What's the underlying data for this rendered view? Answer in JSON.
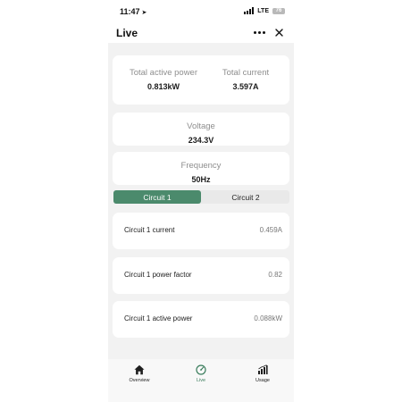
{
  "status_bar": {
    "time": "11:47",
    "network": "LTE",
    "battery": "76"
  },
  "header": {
    "title": "Live"
  },
  "power": {
    "active_label": "Total active power",
    "active_value": "0.813kW",
    "current_label": "Total current",
    "current_value": "3.597A"
  },
  "voltage": {
    "label": "Voltage",
    "value": "234.3V"
  },
  "frequency": {
    "label": "Frequency",
    "value": "50Hz"
  },
  "circuit_tabs": {
    "tab1": "Circuit 1",
    "tab2": "Circuit 2",
    "selected": "Circuit 1"
  },
  "circuit_metrics": [
    {
      "label": "Circuit 1 current",
      "value": "0.459A"
    },
    {
      "label": "Circuit 1 power factor",
      "value": "0.82"
    },
    {
      "label": "Circuit 1 active power",
      "value": "0.088kW"
    }
  ],
  "tab_bar": {
    "items": [
      {
        "label": "Overview",
        "icon": "home-icon"
      },
      {
        "label": "Live",
        "icon": "gauge-icon"
      },
      {
        "label": "Usage",
        "icon": "bar-chart-icon"
      }
    ],
    "active": "Live"
  },
  "colors": {
    "accent": "#4b8a6c",
    "active_tab": "#3a7d5c",
    "background": "#f2f2f2"
  }
}
